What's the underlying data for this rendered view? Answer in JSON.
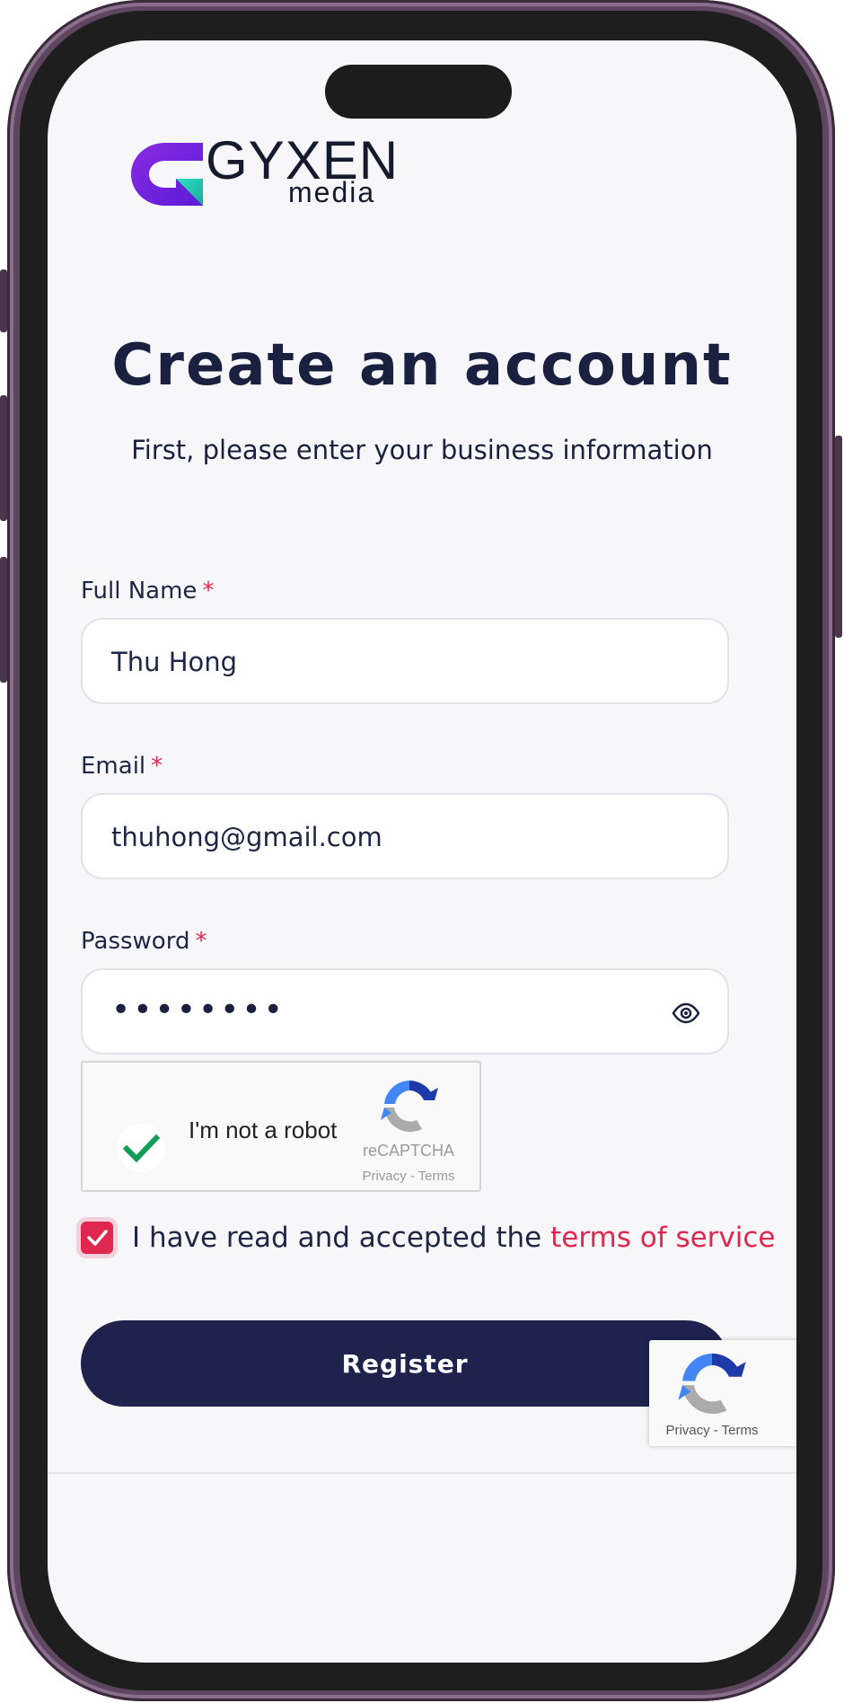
{
  "brand": {
    "name": "GYXEN",
    "sub": "media",
    "colors": {
      "primary": "#1f224d",
      "accent": "#e0274f",
      "logo_purple": "#7b2ff0",
      "logo_teal": "#2fd6c4"
    }
  },
  "heading": {
    "title": "Create an account",
    "subtitle": "First, please enter your business information"
  },
  "form": {
    "full_name": {
      "label": "Full Name",
      "required_mark": "*",
      "value": "Thu Hong"
    },
    "email": {
      "label": "Email",
      "required_mark": "*",
      "value": "thuhong@gmail.com"
    },
    "password": {
      "label": "Password",
      "required_mark": "*",
      "masked_value": "••••••••",
      "toggle_icon": "eye-icon"
    }
  },
  "captcha": {
    "label": "I'm not a robot",
    "brand": "reCAPTCHA",
    "links": "Privacy - Terms",
    "checked": true
  },
  "terms": {
    "checked": true,
    "text": "I have read and accepted the",
    "link": "terms of service"
  },
  "register_button": {
    "label": "Register"
  },
  "captcha_badge": {
    "links": "Privacy - Terms"
  }
}
